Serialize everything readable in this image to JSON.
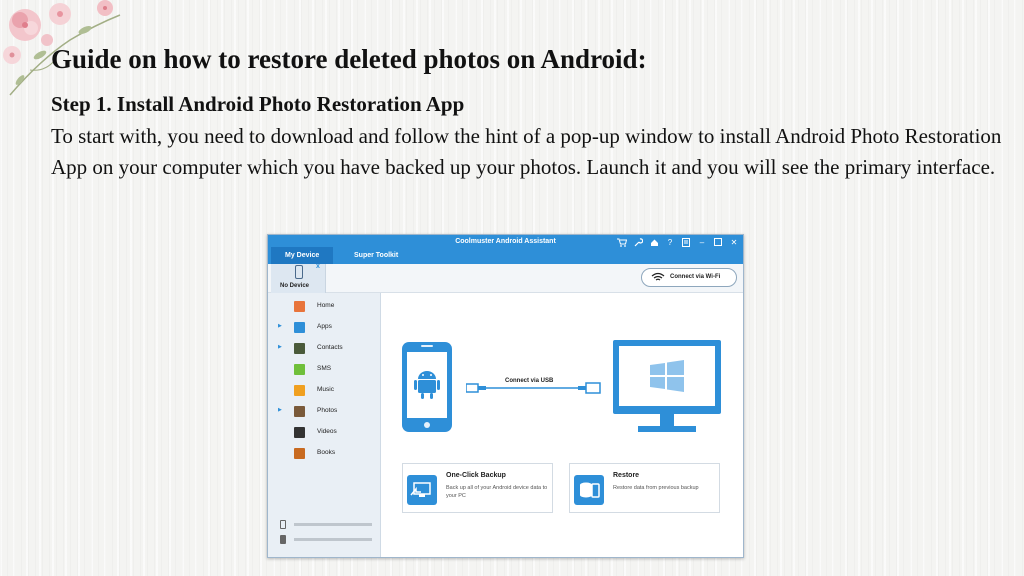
{
  "slide": {
    "title": "Guide on how to restore deleted photos on Android:",
    "step_title": "Step 1. Install Android Photo Restoration App",
    "step_body": "To start with, you need to download and follow the hint of a pop-up window to install Android Photo Restoration App on your computer which you have backed up your photos. Launch it and you will see the primary interface."
  },
  "app": {
    "window_title": "Coolmuster Android Assistant",
    "tabs": [
      {
        "label": "My Device",
        "active": true
      },
      {
        "label": "Super Toolkit",
        "active": false
      }
    ],
    "window_controls": [
      "cart-icon",
      "wrench-icon",
      "home-icon",
      "help-icon",
      "feedback-icon",
      "minimize-icon",
      "maximize-icon",
      "close-icon"
    ],
    "device": {
      "label": "No Device",
      "close": "x"
    },
    "wifi_button": "Connect via Wi-Fi",
    "sidebar": {
      "items": [
        {
          "label": "Home",
          "icon": "home-icon",
          "expandable": false,
          "color": "#e8743b"
        },
        {
          "label": "Apps",
          "icon": "apps-icon",
          "expandable": true,
          "color": "#2e8fd8"
        },
        {
          "label": "Contacts",
          "icon": "contacts-icon",
          "expandable": true,
          "color": "#4a5a3a"
        },
        {
          "label": "SMS",
          "icon": "sms-icon",
          "expandable": false,
          "color": "#6fbf3a"
        },
        {
          "label": "Music",
          "icon": "music-icon",
          "expandable": false,
          "color": "#f0a020"
        },
        {
          "label": "Photos",
          "icon": "photos-icon",
          "expandable": true,
          "color": "#7a5a3a"
        },
        {
          "label": "Videos",
          "icon": "videos-icon",
          "expandable": false,
          "color": "#333333"
        },
        {
          "label": "Books",
          "icon": "books-icon",
          "expandable": false,
          "color": "#c86a20"
        }
      ]
    },
    "main": {
      "usb_label": "Connect via USB",
      "cards": [
        {
          "title": "One-Click Backup",
          "desc": "Back up all of your Android device data to your PC",
          "icon": "backup-icon"
        },
        {
          "title": "Restore",
          "desc": "Restore data from previous backup",
          "icon": "restore-icon"
        }
      ]
    },
    "colors": {
      "accent": "#2e8fd8",
      "accent_dark": "#1f78c2"
    }
  }
}
